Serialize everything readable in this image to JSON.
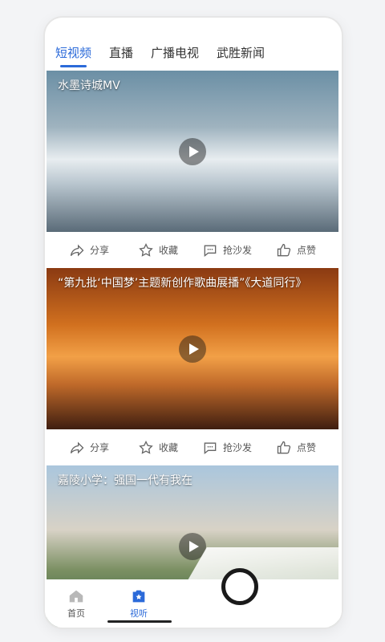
{
  "tabs": [
    {
      "label": "短视频",
      "active": true
    },
    {
      "label": "直播",
      "active": false
    },
    {
      "label": "广播电视",
      "active": false
    },
    {
      "label": "武胜新闻",
      "active": false
    }
  ],
  "videos": [
    {
      "title": "水墨诗城MV"
    },
    {
      "title": "“第九批‘中国梦’主题新创作歌曲展播”《大道同行》"
    },
    {
      "title": "嘉陵小学：强国一代有我在"
    }
  ],
  "actions": {
    "share": "分享",
    "favorite": "收藏",
    "comment": "抢沙发",
    "like": "点赞"
  },
  "bottom_nav": [
    {
      "label": "首页",
      "icon": "home-icon",
      "active": false
    },
    {
      "label": "视听",
      "icon": "video-icon",
      "active": true
    }
  ],
  "colors": {
    "accent": "#2b6ad9"
  }
}
